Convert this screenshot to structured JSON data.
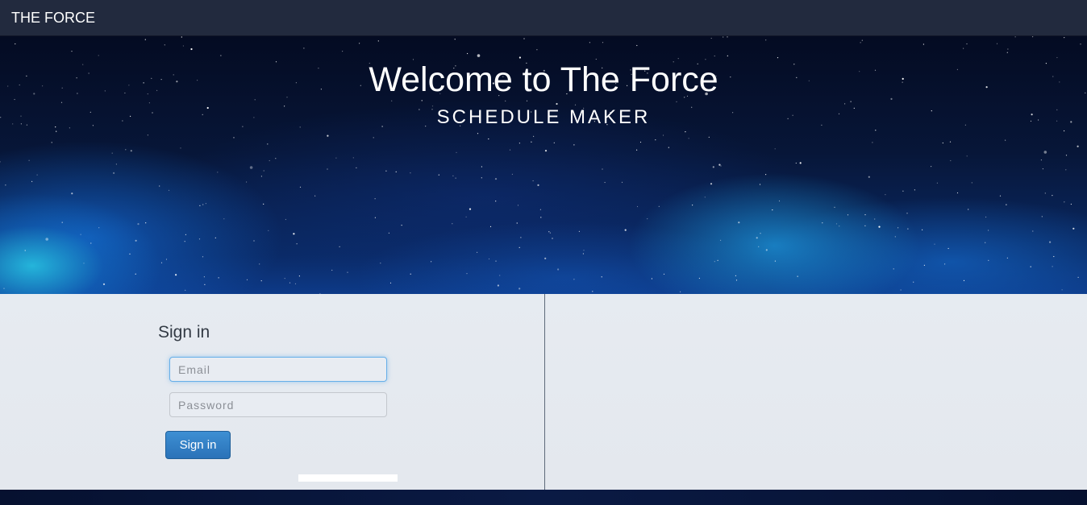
{
  "navbar": {
    "brand": "THE FORCE"
  },
  "hero": {
    "title": "Welcome to The Force",
    "subtitle": "SCHEDULE MAKER"
  },
  "signin": {
    "heading": "Sign in",
    "email_placeholder": "Email",
    "email_value": "",
    "password_placeholder": "Password",
    "password_value": "",
    "button_label": "Sign in"
  },
  "colors": {
    "navbar_bg": "#222a3e",
    "panel_bg": "#e6ebf1",
    "button_bg": "#2a72b8",
    "focus_border": "#66afe9"
  }
}
